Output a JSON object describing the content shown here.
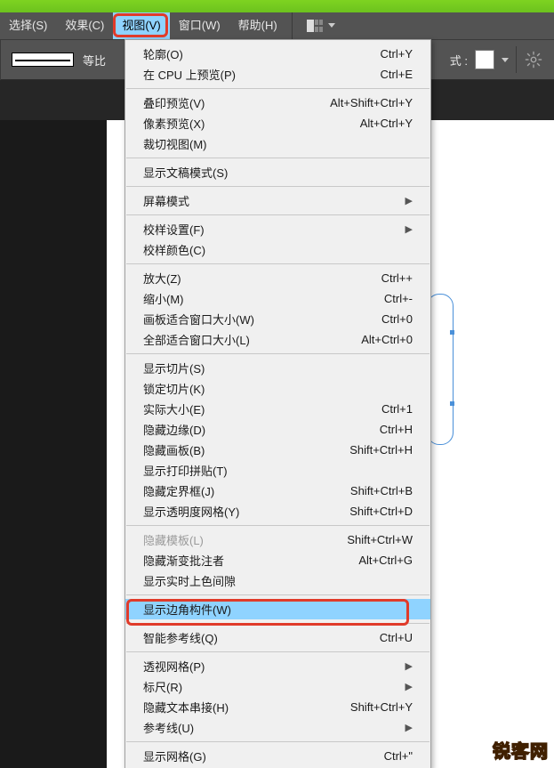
{
  "menubar": {
    "items": [
      "选择(S)",
      "效果(C)",
      "视图(V)",
      "窗口(W)",
      "帮助(H)"
    ],
    "openIndex": 2
  },
  "toolbar": {
    "label_left": "等比",
    "label_right": "式 :"
  },
  "dropdown": {
    "groups": [
      [
        {
          "label": "轮廓(O)",
          "shortcut": "Ctrl+Y"
        },
        {
          "label": "在 CPU 上预览(P)",
          "shortcut": "Ctrl+E"
        }
      ],
      [
        {
          "label": "叠印预览(V)",
          "shortcut": "Alt+Shift+Ctrl+Y"
        },
        {
          "label": "像素预览(X)",
          "shortcut": "Alt+Ctrl+Y"
        },
        {
          "label": "裁切视图(M)",
          "shortcut": ""
        }
      ],
      [
        {
          "label": "显示文稿模式(S)",
          "shortcut": ""
        }
      ],
      [
        {
          "label": "屏幕模式",
          "shortcut": "",
          "submenu": true
        }
      ],
      [
        {
          "label": "校样设置(F)",
          "shortcut": "",
          "submenu": true
        },
        {
          "label": "校样颜色(C)",
          "shortcut": ""
        }
      ],
      [
        {
          "label": "放大(Z)",
          "shortcut": "Ctrl++"
        },
        {
          "label": "缩小(M)",
          "shortcut": "Ctrl+-"
        },
        {
          "label": "画板适合窗口大小(W)",
          "shortcut": "Ctrl+0"
        },
        {
          "label": "全部适合窗口大小(L)",
          "shortcut": "Alt+Ctrl+0"
        }
      ],
      [
        {
          "label": "显示切片(S)",
          "shortcut": ""
        },
        {
          "label": "锁定切片(K)",
          "shortcut": ""
        },
        {
          "label": "实际大小(E)",
          "shortcut": "Ctrl+1"
        },
        {
          "label": "隐藏边缘(D)",
          "shortcut": "Ctrl+H"
        },
        {
          "label": "隐藏画板(B)",
          "shortcut": "Shift+Ctrl+H"
        },
        {
          "label": "显示打印拼贴(T)",
          "shortcut": ""
        },
        {
          "label": "隐藏定界框(J)",
          "shortcut": "Shift+Ctrl+B"
        },
        {
          "label": "显示透明度网格(Y)",
          "shortcut": "Shift+Ctrl+D"
        }
      ],
      [
        {
          "label": "隐藏模板(L)",
          "shortcut": "Shift+Ctrl+W",
          "disabled": true
        },
        {
          "label": "隐藏渐变批注者",
          "shortcut": "Alt+Ctrl+G"
        },
        {
          "label": "显示实时上色间隙",
          "shortcut": ""
        }
      ],
      [
        {
          "label": "显示边角构件(W)",
          "shortcut": "",
          "hover": true
        }
      ],
      [
        {
          "label": "智能参考线(Q)",
          "shortcut": "Ctrl+U"
        }
      ],
      [
        {
          "label": "透视网格(P)",
          "shortcut": "",
          "submenu": true
        },
        {
          "label": "标尺(R)",
          "shortcut": "",
          "submenu": true
        },
        {
          "label": "隐藏文本串接(H)",
          "shortcut": "Shift+Ctrl+Y"
        },
        {
          "label": "参考线(U)",
          "shortcut": "",
          "submenu": true
        }
      ],
      [
        {
          "label": "显示网格(G)",
          "shortcut": "Ctrl+\""
        }
      ]
    ]
  },
  "watermark": "锐客网"
}
